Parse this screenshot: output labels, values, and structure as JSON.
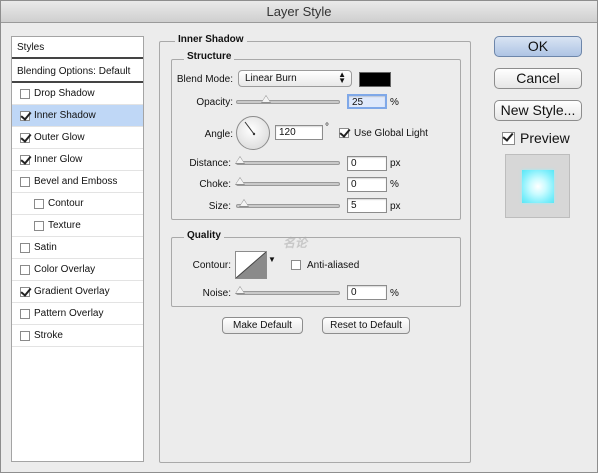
{
  "window": {
    "title": "Layer Style"
  },
  "styles_list": {
    "header": "Styles",
    "items": [
      {
        "label": "Blending Options: Default",
        "type": "header",
        "checkbox": false
      },
      {
        "label": "Drop Shadow",
        "checked": false
      },
      {
        "label": "Inner Shadow",
        "checked": true,
        "selected": true
      },
      {
        "label": "Outer Glow",
        "checked": true
      },
      {
        "label": "Inner Glow",
        "checked": true
      },
      {
        "label": "Bevel and Emboss",
        "checked": false
      },
      {
        "label": "Contour",
        "checked": false,
        "indent": true
      },
      {
        "label": "Texture",
        "checked": false,
        "indent": true
      },
      {
        "label": "Satin",
        "checked": false
      },
      {
        "label": "Color Overlay",
        "checked": false
      },
      {
        "label": "Gradient Overlay",
        "checked": true
      },
      {
        "label": "Pattern Overlay",
        "checked": false
      },
      {
        "label": "Stroke",
        "checked": false
      }
    ]
  },
  "panel": {
    "title": "Inner Shadow",
    "structure": {
      "title": "Structure",
      "blend_mode_label": "Blend Mode:",
      "blend_mode_value": "Linear Burn",
      "blend_color": "#000000",
      "opacity_label": "Opacity:",
      "opacity_value": "25",
      "opacity_unit": "%",
      "opacity_level": 0.25,
      "angle_label": "Angle:",
      "angle_value": "120",
      "angle_unit": "°",
      "use_global_light_label": "Use Global Light",
      "use_global_light": true,
      "distance_label": "Distance:",
      "distance_value": "0",
      "distance_unit": "px",
      "choke_label": "Choke:",
      "choke_value": "0",
      "choke_unit": "%",
      "size_label": "Size:",
      "size_value": "5",
      "size_unit": "px"
    },
    "quality": {
      "title": "Quality",
      "contour_label": "Contour:",
      "anti_aliased_label": "Anti-aliased",
      "anti_aliased": false,
      "noise_label": "Noise:",
      "noise_value": "0",
      "noise_unit": "%"
    },
    "make_default_label": "Make Default",
    "reset_default_label": "Reset to Default"
  },
  "buttons": {
    "ok": "OK",
    "cancel": "Cancel",
    "new_style": "New Style..."
  },
  "preview": {
    "label": "Preview",
    "checked": true
  },
  "watermark": "名论"
}
